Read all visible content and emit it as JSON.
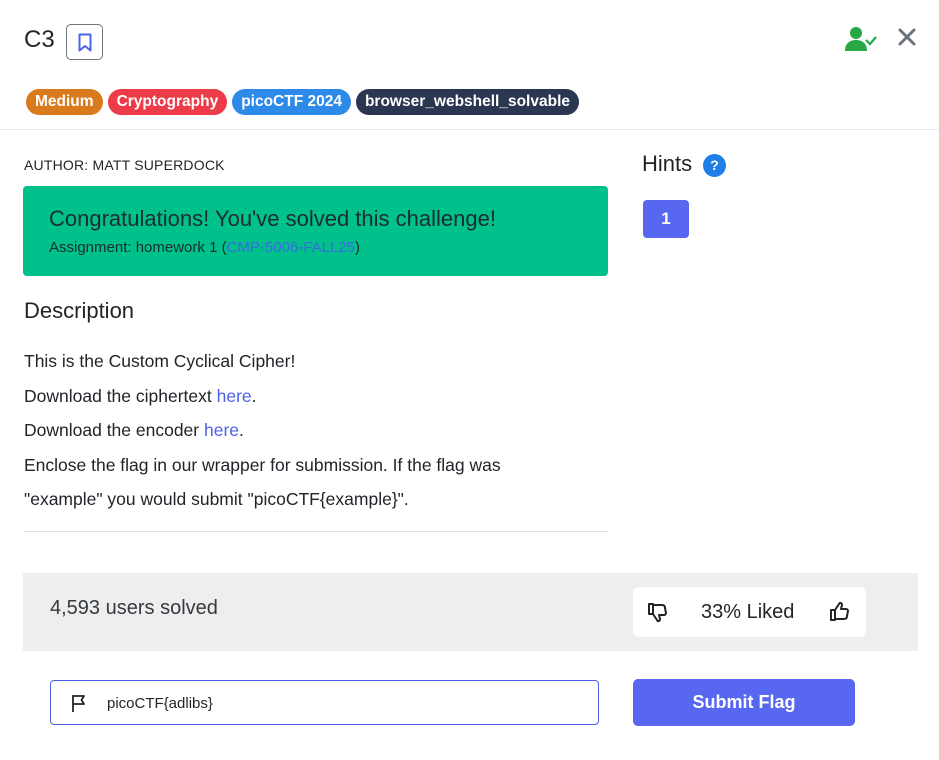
{
  "challenge": {
    "title": "C3",
    "tags": [
      {
        "label": "Medium",
        "color": "#d97a1c"
      },
      {
        "label": "Cryptography",
        "color": "#ee3b4a"
      },
      {
        "label": "picoCTF 2024",
        "color": "#2d8ae8"
      },
      {
        "label": "browser_webshell_solvable",
        "color": "#2b3650"
      }
    ],
    "author": "AUTHOR: MATT SUPERDOCK"
  },
  "success": {
    "title": "Congratulations! You've solved this challenge!",
    "assignment_prefix": "Assignment: homework 1 (",
    "course": "CMP-5006-FALL25",
    "assignment_suffix": ")"
  },
  "description": {
    "heading": "Description",
    "line1": "This is the Custom Cyclical Cipher!",
    "line2_prefix": "Download the ciphertext ",
    "line2_link": "here",
    "line2_suffix": ".",
    "line3_prefix": "Download the encoder ",
    "line3_link": "here",
    "line3_suffix": ".",
    "line4": "Enclose the flag in our wrapper for submission. If the flag was \"example\" you would submit \"picoCTF{example}\"."
  },
  "hints": {
    "heading": "Hints",
    "help_glyph": "?",
    "items": [
      "1"
    ]
  },
  "stats": {
    "solved": "4,593 users solved",
    "liked": "33% Liked"
  },
  "flag": {
    "value": "picoCTF{adlibs}",
    "submit_label": "Submit Flag"
  },
  "colors": {
    "success_bg": "#00c08b",
    "accent": "#5867f0",
    "link": "#4d62e8",
    "user_check": "#28a745"
  }
}
